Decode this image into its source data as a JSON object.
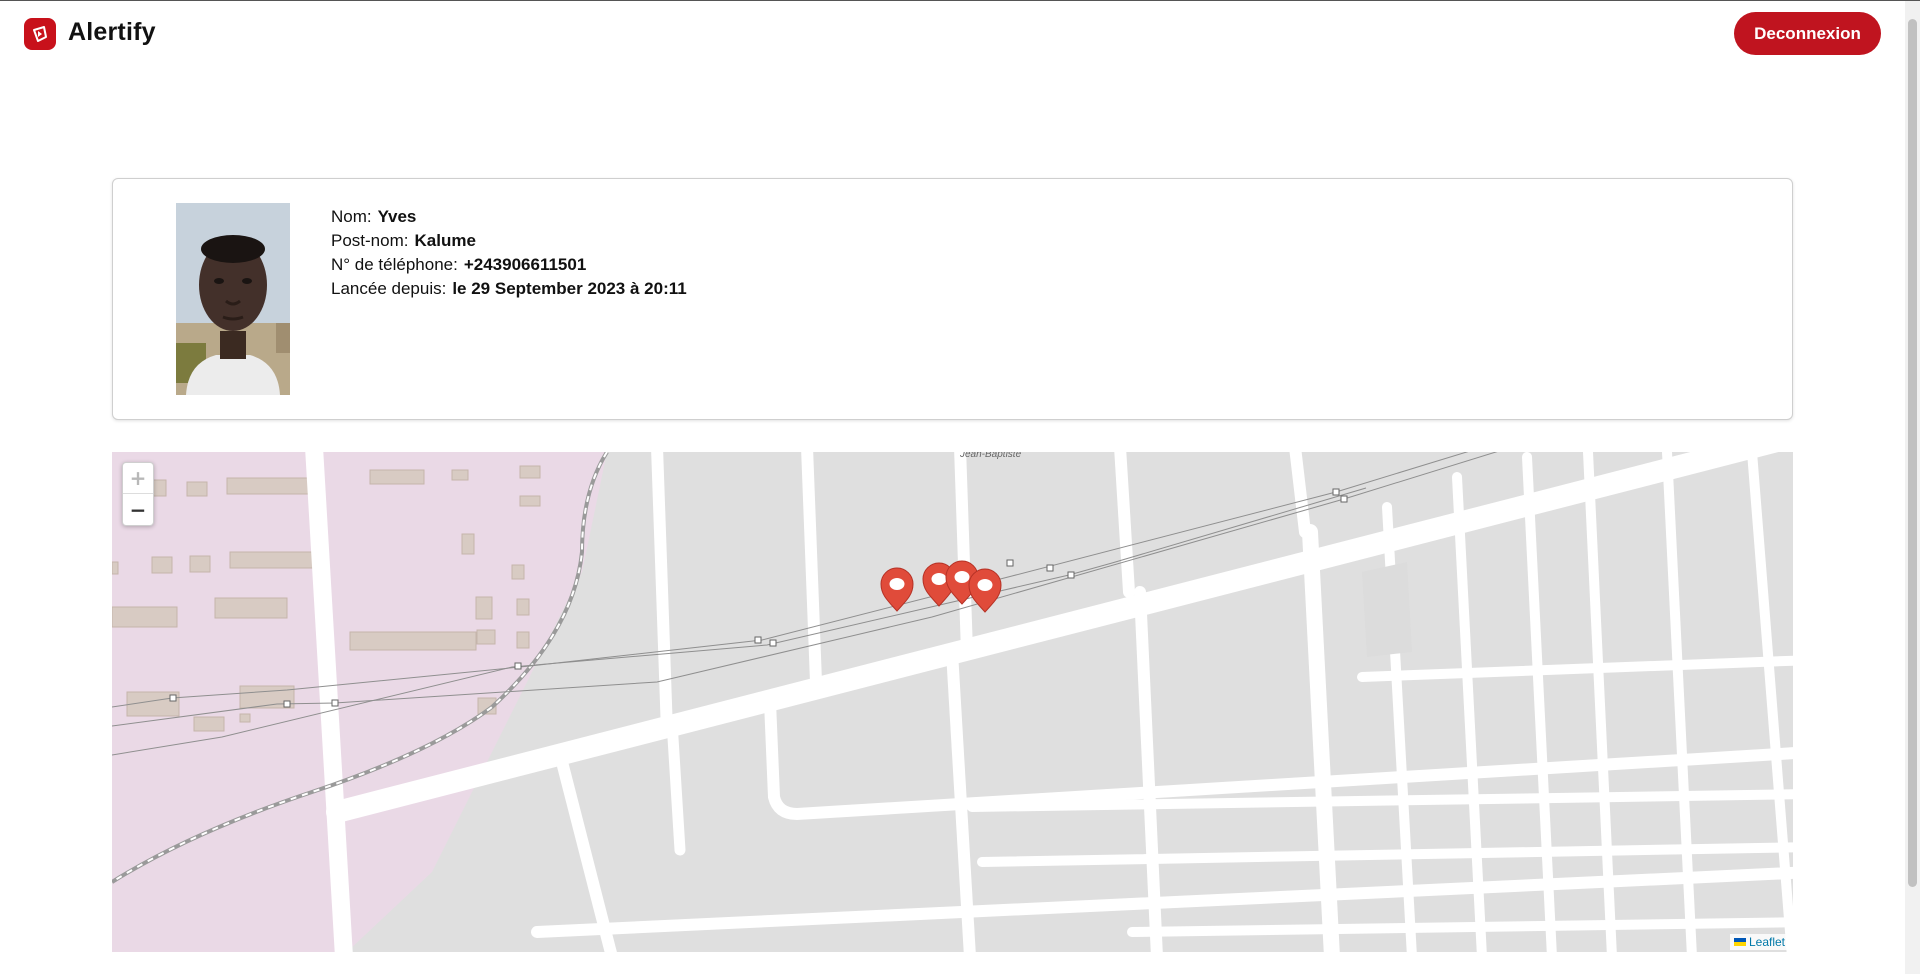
{
  "app": {
    "name": "Alertify",
    "logout_label": "Deconnexion",
    "brand_color": "#c0141f"
  },
  "profile": {
    "photo_icon": "person-photo",
    "fields": [
      {
        "label": "Nom:",
        "value": "Yves"
      },
      {
        "label": "Post-nom:",
        "value": "Kalume"
      },
      {
        "label": "N° de téléphone:",
        "value": "+243906611501"
      },
      {
        "label": "Lancée depuis:",
        "value": "le 29 September 2023 à 20:11"
      }
    ]
  },
  "map": {
    "zoom_in": "+",
    "zoom_out": "−",
    "attribution": "Leaflet",
    "street_label": "Jean-Baptiste",
    "marker_color": "#e04b3a",
    "marker_count": 4
  }
}
